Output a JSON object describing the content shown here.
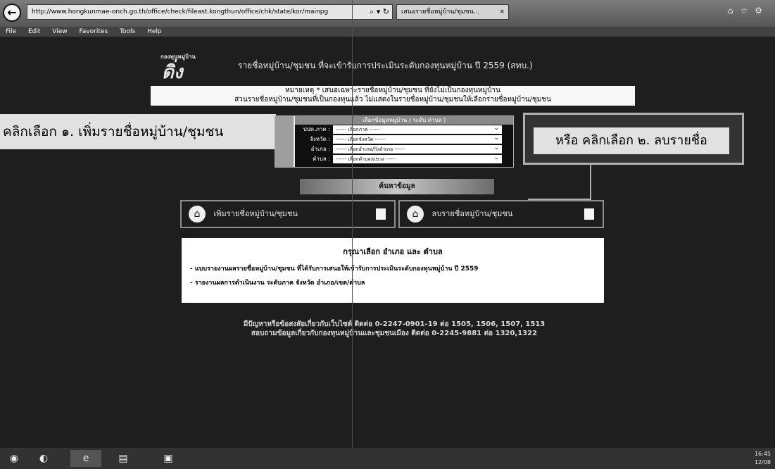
{
  "browser": {
    "address": "http://www.hongkunmae-onch.go.th/office/check/fileast.kongthun/office/chk/state/kor/mainpg",
    "tab_label": "เสนอรายชื่อหมู่บ้าน/ชุมชน...",
    "menu": [
      "File",
      "Edit",
      "View",
      "Favorites",
      "Tools",
      "Help"
    ]
  },
  "header": {
    "logo": "กองทุนหมู่บ้าน",
    "title": "รายชื่อหมู่บ้าน/ชุมชน ที่จะเข้ารับการประเมินระดับกองทุนหมู่บ้าน ปี 2559 (สทบ.)"
  },
  "notice": {
    "line1": "หมายเหตุ * เสนอเฉพาะรายชื่อหมู่บ้าน/ชุมชน ที่ยังไม่เป็นกองทุนหมู่บ้าน",
    "line2": "ส่วนรายชื่อหมู่บ้าน/ชุมชนที่เป็นกองทุนแล้ว ไม่แสดงในรายชื่อหมู่บ้าน/ชุมชนให้เลือกรายชื่อหมู่บ้าน/ชุมชน"
  },
  "form": {
    "heading": "เลือกข้อมูลหมู่บ้าน ( ระดับ ตำบล )",
    "rows": [
      {
        "label": "ปปค.ภาค :",
        "value": "------ เลือกภาค ------"
      },
      {
        "label": "จังหวัด :",
        "value": "------ เลือกจังหวัด ------"
      },
      {
        "label": "อำเภอ :",
        "value": "------ เลือกอำเภอ/กิ่งอำเภอ ------"
      },
      {
        "label": "ตำบล :",
        "value": "------ เลือกตำบล/แขวง ------"
      }
    ]
  },
  "callouts": {
    "left": "คลิกเลือก ๑. เพิ่มรายชื่อหมู่บ้าน/ชุมชน",
    "right": "หรือ คลิกเลือก ๒. ลบรายชื่อ"
  },
  "search_button": "ค้นหาข้อมูล",
  "buttons": {
    "add": "เพิ่มรายชื่อหมู่บ้าน/ชุมชน",
    "delete": "ลบรายชื่อหมู่บ้าน/ชุมชน"
  },
  "info": {
    "title": "กรุณาเลือก อำเภอ และ ตำบล",
    "line1": "- แบบรายงานผลรายชื่อหมู่บ้าน/ชุมชน ที่ได้รับการเสนอให้เข้ารับการประเมินระดับกองทุนหมู่บ้าน ปี 2559",
    "line2": "- รายงานผลการดำเนินงาน ระดับภาค จังหวัด อำเภอ/เขต/ตำบล"
  },
  "footer": {
    "line1": "มีปัญหาหรือข้อสงสัยเกี่ยวกับเว็บไซต์ ติดต่อ 0-2247-0901-19 ต่อ 1505, 1506, 1507, 1513",
    "line2": "สอบถามข้อมูลเกี่ยวกับกองทุนหมู่บ้านและชุมชนเมือง ติดต่อ 0-2245-9881 ต่อ 1320,1322"
  },
  "taskbar": {
    "time": "16:45",
    "date": "12/08"
  }
}
